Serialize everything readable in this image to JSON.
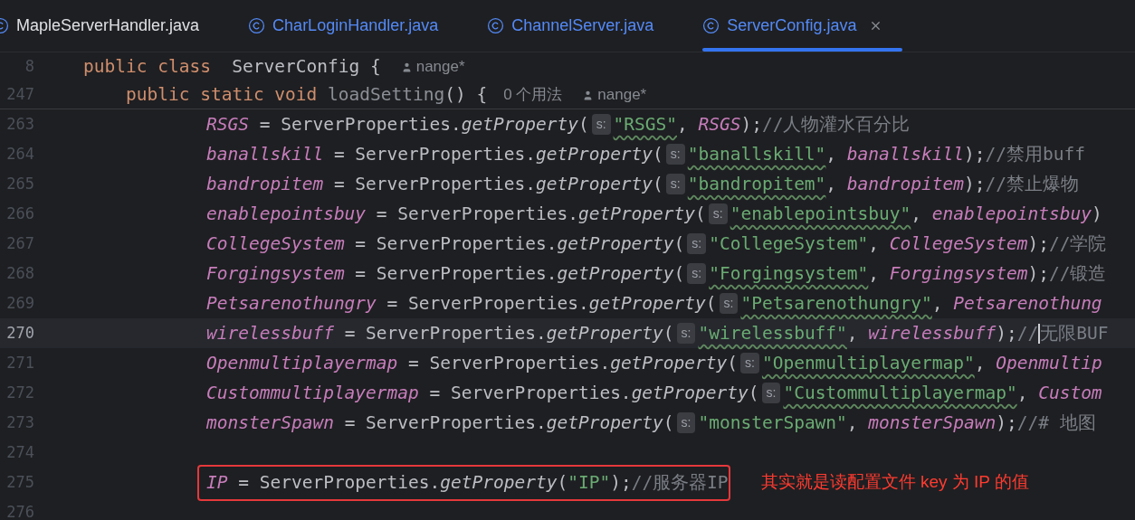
{
  "tabs": [
    {
      "label": "MapleServerHandler.java",
      "selected": false,
      "modified": false
    },
    {
      "label": "CharLoginHandler.java",
      "selected": false,
      "modified": true
    },
    {
      "label": "ChannelServer.java",
      "selected": false,
      "modified": true
    },
    {
      "label": "ServerConfig.java",
      "selected": true,
      "modified": true
    }
  ],
  "sticky_lines": [
    {
      "number": "8",
      "tokens": [
        {
          "kind": "keyword",
          "text": "public class"
        },
        {
          "kind": "plain",
          "text": " ServerConfig {"
        },
        {
          "kind": "author",
          "text": "nange*"
        }
      ]
    },
    {
      "number": "247",
      "tokens": [
        {
          "kind": "keyword",
          "text": "public static void"
        },
        {
          "kind": "unused",
          "text": "loadSetting"
        },
        {
          "kind": "plain",
          "text": "() {"
        },
        {
          "kind": "usages",
          "text": "0 个用法"
        },
        {
          "kind": "author",
          "text": "nange*"
        }
      ]
    }
  ],
  "lines": [
    {
      "number": "263",
      "current": false,
      "boxed": false,
      "tokens": [
        {
          "kind": "field",
          "text": "RSGS"
        },
        {
          "kind": "plain",
          "text": " = ServerProperties."
        },
        {
          "kind": "call",
          "text": "getProperty"
        },
        {
          "kind": "plain",
          "text": "("
        },
        {
          "kind": "hint",
          "text": "s:"
        },
        {
          "kind": "string",
          "text": "\"RSGS\"",
          "typo": true
        },
        {
          "kind": "plain",
          "text": ", "
        },
        {
          "kind": "field",
          "text": "RSGS"
        },
        {
          "kind": "plain",
          "text": ");"
        },
        {
          "kind": "comment",
          "text": "//人物灌水百分比"
        }
      ]
    },
    {
      "number": "264",
      "current": false,
      "boxed": false,
      "tokens": [
        {
          "kind": "field",
          "text": "banallskill"
        },
        {
          "kind": "plain",
          "text": " = ServerProperties."
        },
        {
          "kind": "call",
          "text": "getProperty"
        },
        {
          "kind": "plain",
          "text": "("
        },
        {
          "kind": "hint",
          "text": "s:"
        },
        {
          "kind": "string",
          "text": "\"banallskill\"",
          "typo": true
        },
        {
          "kind": "plain",
          "text": ", "
        },
        {
          "kind": "field",
          "text": "banallskill"
        },
        {
          "kind": "plain",
          "text": ");"
        },
        {
          "kind": "comment",
          "text": "//禁用buff"
        }
      ]
    },
    {
      "number": "265",
      "current": false,
      "boxed": false,
      "tokens": [
        {
          "kind": "field",
          "text": "bandropitem"
        },
        {
          "kind": "plain",
          "text": " = ServerProperties."
        },
        {
          "kind": "call",
          "text": "getProperty"
        },
        {
          "kind": "plain",
          "text": "("
        },
        {
          "kind": "hint",
          "text": "s:"
        },
        {
          "kind": "string",
          "text": "\"bandropitem\"",
          "typo": true
        },
        {
          "kind": "plain",
          "text": ", "
        },
        {
          "kind": "field",
          "text": "bandropitem"
        },
        {
          "kind": "plain",
          "text": ");"
        },
        {
          "kind": "comment",
          "text": "//禁止爆物"
        }
      ]
    },
    {
      "number": "266",
      "current": false,
      "boxed": false,
      "tokens": [
        {
          "kind": "field",
          "text": "enablepointsbuy"
        },
        {
          "kind": "plain",
          "text": " = ServerProperties."
        },
        {
          "kind": "call",
          "text": "getProperty"
        },
        {
          "kind": "plain",
          "text": "("
        },
        {
          "kind": "hint",
          "text": "s:"
        },
        {
          "kind": "string",
          "text": "\"enablepointsbuy\"",
          "typo": true
        },
        {
          "kind": "plain",
          "text": ", "
        },
        {
          "kind": "field",
          "text": "enablepointsbuy"
        },
        {
          "kind": "plain",
          "text": ")"
        }
      ]
    },
    {
      "number": "267",
      "current": false,
      "boxed": false,
      "tokens": [
        {
          "kind": "field",
          "text": "CollegeSystem"
        },
        {
          "kind": "plain",
          "text": " = ServerProperties."
        },
        {
          "kind": "call",
          "text": "getProperty"
        },
        {
          "kind": "plain",
          "text": "("
        },
        {
          "kind": "hint",
          "text": "s:"
        },
        {
          "kind": "string",
          "text": "\"CollegeSystem\"",
          "typo": false
        },
        {
          "kind": "plain",
          "text": ", "
        },
        {
          "kind": "field",
          "text": "CollegeSystem"
        },
        {
          "kind": "plain",
          "text": ");"
        },
        {
          "kind": "comment",
          "text": "//学院"
        }
      ]
    },
    {
      "number": "268",
      "current": false,
      "boxed": false,
      "tokens": [
        {
          "kind": "field",
          "text": "Forgingsystem"
        },
        {
          "kind": "plain",
          "text": " = ServerProperties."
        },
        {
          "kind": "call",
          "text": "getProperty"
        },
        {
          "kind": "plain",
          "text": "("
        },
        {
          "kind": "hint",
          "text": "s:"
        },
        {
          "kind": "string",
          "text": "\"Forgingsystem\"",
          "typo": true
        },
        {
          "kind": "plain",
          "text": ", "
        },
        {
          "kind": "field",
          "text": "Forgingsystem"
        },
        {
          "kind": "plain",
          "text": ");"
        },
        {
          "kind": "comment",
          "text": "//锻造"
        }
      ]
    },
    {
      "number": "269",
      "current": false,
      "boxed": false,
      "tokens": [
        {
          "kind": "field",
          "text": "Petsarenothungry"
        },
        {
          "kind": "plain",
          "text": " = ServerProperties."
        },
        {
          "kind": "call",
          "text": "getProperty"
        },
        {
          "kind": "plain",
          "text": "("
        },
        {
          "kind": "hint",
          "text": "s:"
        },
        {
          "kind": "string",
          "text": "\"Petsarenothungry\"",
          "typo": true
        },
        {
          "kind": "plain",
          "text": ", "
        },
        {
          "kind": "field",
          "text": "Petsarenothung"
        }
      ]
    },
    {
      "number": "270",
      "current": true,
      "boxed": false,
      "tokens": [
        {
          "kind": "field",
          "text": "wirelessbuff"
        },
        {
          "kind": "plain",
          "text": " = ServerProperties."
        },
        {
          "kind": "call",
          "text": "getProperty"
        },
        {
          "kind": "plain",
          "text": "("
        },
        {
          "kind": "hint",
          "text": "s:"
        },
        {
          "kind": "string",
          "text": "\"wirelessbuff\"",
          "typo": true
        },
        {
          "kind": "plain",
          "text": ", "
        },
        {
          "kind": "field",
          "text": "wirelessbuff"
        },
        {
          "kind": "plain",
          "text": ");"
        },
        {
          "kind": "comment",
          "text": "//"
        },
        {
          "kind": "caret"
        },
        {
          "kind": "comment",
          "text": "无限BUF"
        }
      ]
    },
    {
      "number": "271",
      "current": false,
      "boxed": false,
      "tokens": [
        {
          "kind": "field",
          "text": "Openmultiplayermap"
        },
        {
          "kind": "plain",
          "text": " = ServerProperties."
        },
        {
          "kind": "call",
          "text": "getProperty"
        },
        {
          "kind": "plain",
          "text": "("
        },
        {
          "kind": "hint",
          "text": "s:"
        },
        {
          "kind": "string",
          "text": "\"Openmultiplayermap\"",
          "typo": true
        },
        {
          "kind": "plain",
          "text": ", "
        },
        {
          "kind": "field",
          "text": "Openmultip"
        }
      ]
    },
    {
      "number": "272",
      "current": false,
      "boxed": false,
      "tokens": [
        {
          "kind": "field",
          "text": "Custommultiplayermap"
        },
        {
          "kind": "plain",
          "text": " = ServerProperties."
        },
        {
          "kind": "call",
          "text": "getProperty"
        },
        {
          "kind": "plain",
          "text": "("
        },
        {
          "kind": "hint",
          "text": "s:"
        },
        {
          "kind": "string",
          "text": "\"Custommultiplayermap\"",
          "typo": true
        },
        {
          "kind": "plain",
          "text": ", "
        },
        {
          "kind": "field",
          "text": "Custom"
        }
      ]
    },
    {
      "number": "273",
      "current": false,
      "boxed": false,
      "tokens": [
        {
          "kind": "field",
          "text": "monsterSpawn"
        },
        {
          "kind": "plain",
          "text": " = ServerProperties."
        },
        {
          "kind": "call",
          "text": "getProperty"
        },
        {
          "kind": "plain",
          "text": "("
        },
        {
          "kind": "hint",
          "text": "s:"
        },
        {
          "kind": "string",
          "text": "\"monsterSpawn\"",
          "typo": false
        },
        {
          "kind": "plain",
          "text": ", "
        },
        {
          "kind": "field",
          "text": "monsterSpawn"
        },
        {
          "kind": "plain",
          "text": ");"
        },
        {
          "kind": "comment",
          "text": "//# 地图"
        }
      ]
    },
    {
      "number": "274",
      "current": false,
      "boxed": false
    },
    {
      "number": "275",
      "current": false,
      "boxed": true,
      "note": "其实就是读配置文件 key 为 IP 的值",
      "tokens": [
        {
          "kind": "field",
          "text": "IP"
        },
        {
          "kind": "plain",
          "text": " = ServerProperties."
        },
        {
          "kind": "call",
          "text": "getProperty"
        },
        {
          "kind": "plain",
          "text": "("
        },
        {
          "kind": "string",
          "text": "\"IP\"",
          "typo": false
        },
        {
          "kind": "plain",
          "text": ");"
        },
        {
          "kind": "comment",
          "text": "//服务器IP"
        }
      ]
    },
    {
      "number": "276",
      "current": false,
      "boxed": false
    }
  ]
}
